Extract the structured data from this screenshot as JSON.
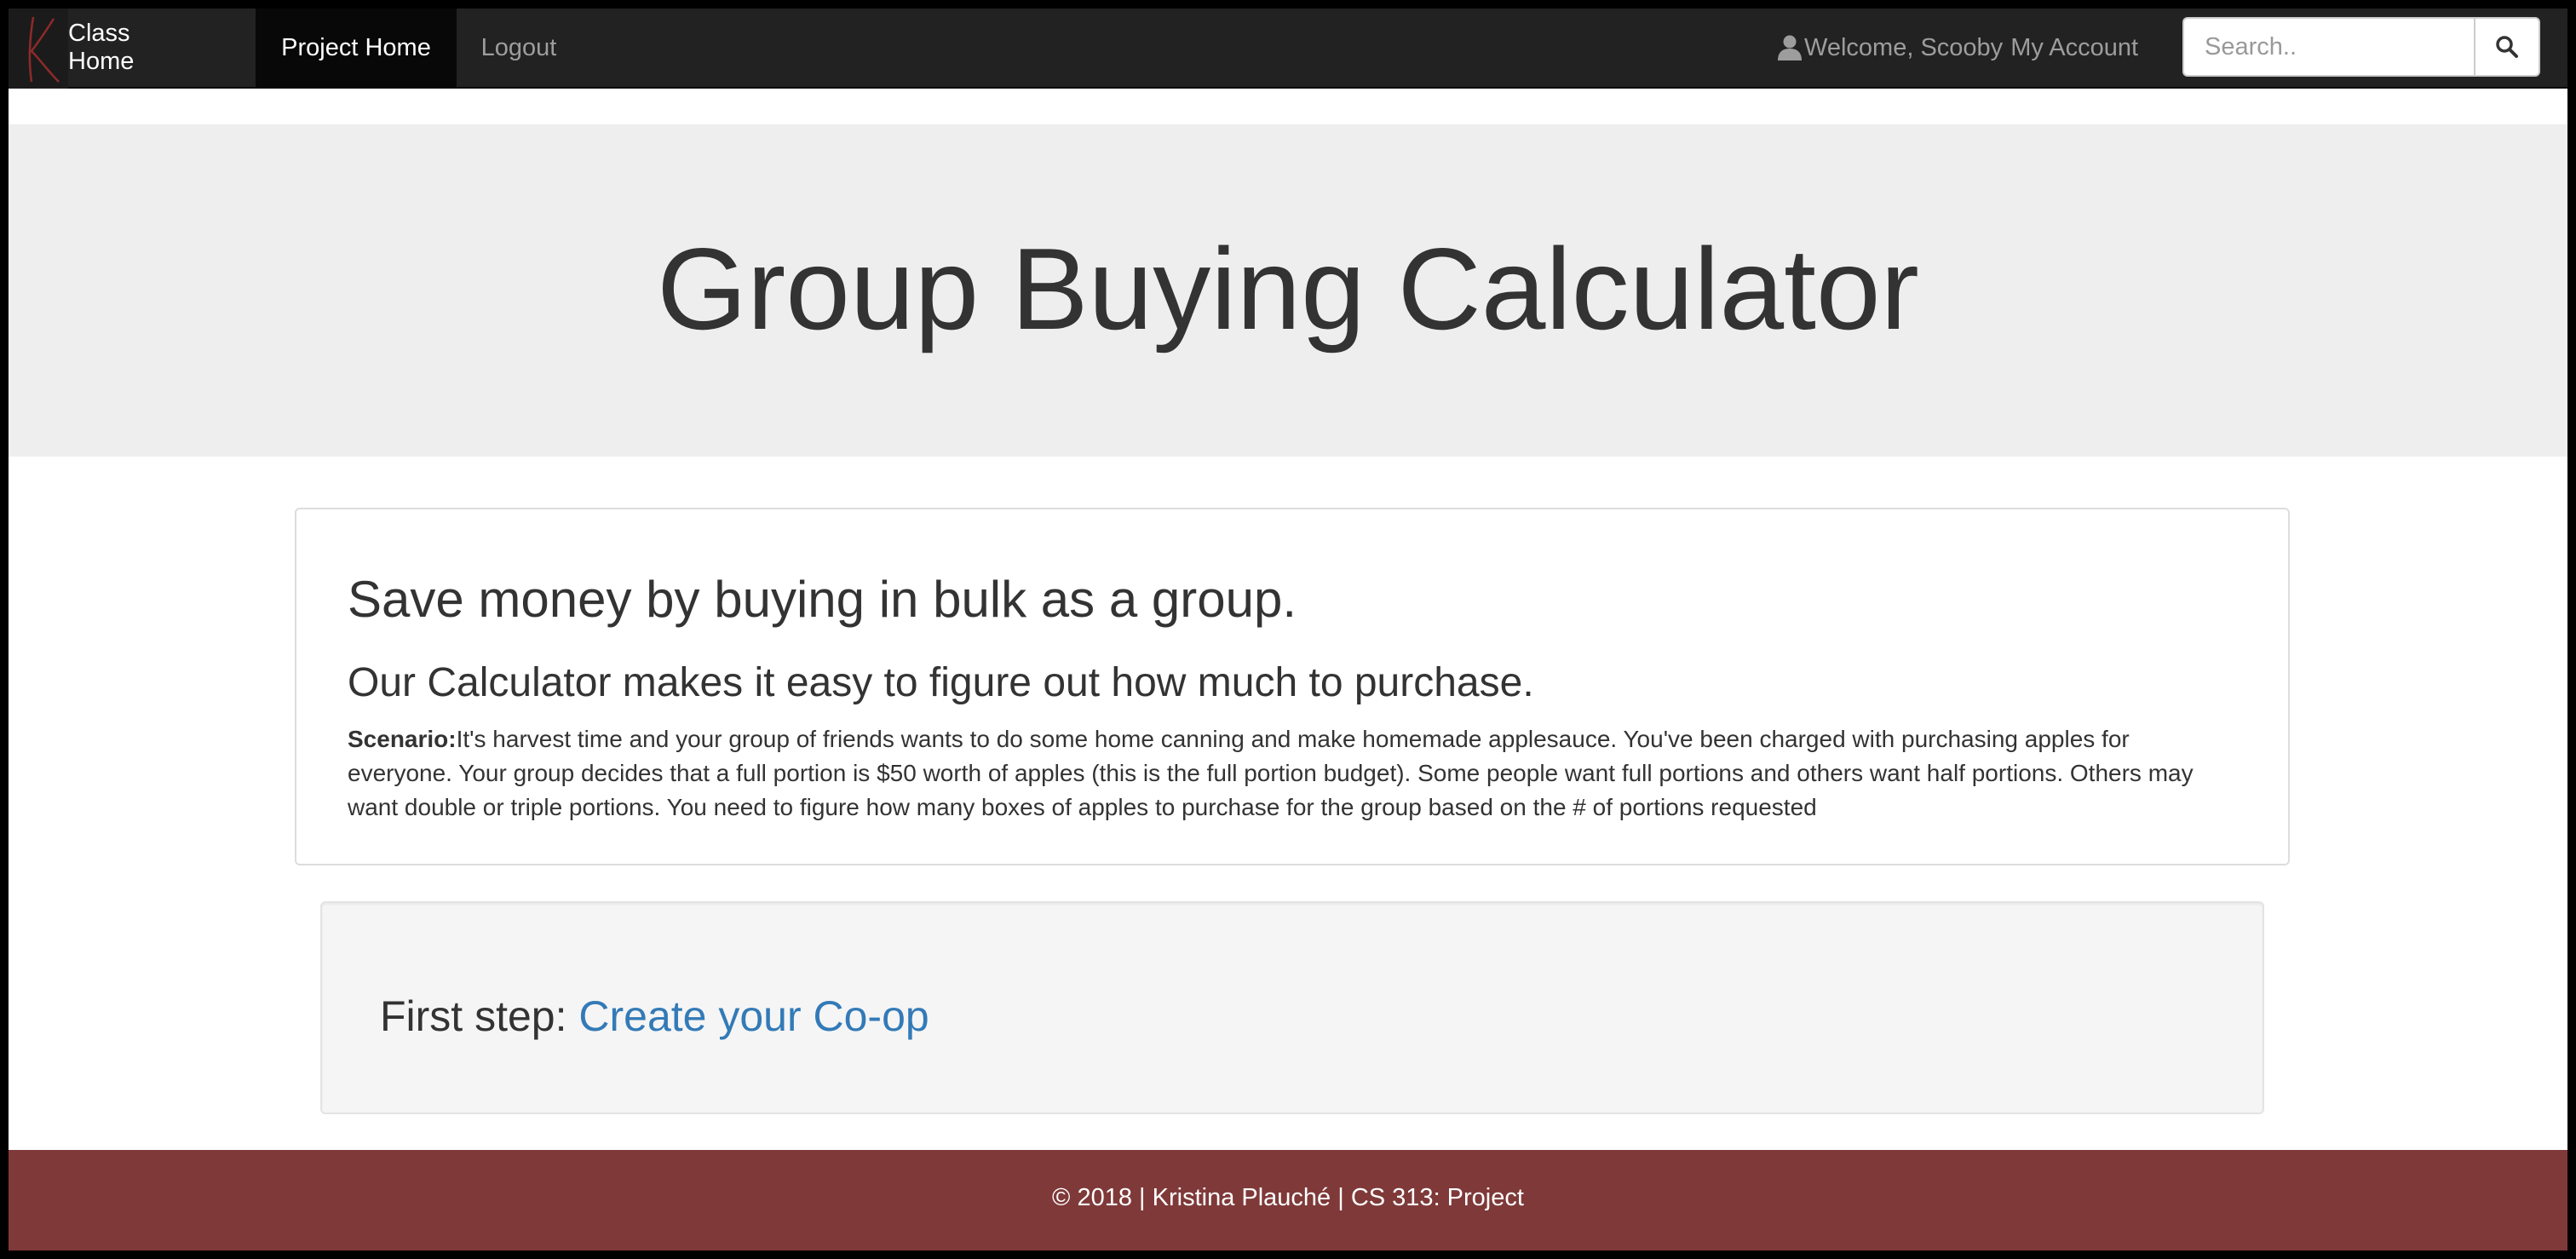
{
  "colors": {
    "navbar": "#222222",
    "navbar_active": "#080808",
    "jumbotron": "#eeeeee",
    "link": "#337ab7",
    "footer": "#7f3939"
  },
  "navbar": {
    "brand_icon": "k-logo-icon",
    "links": [
      {
        "label": "Class Home"
      },
      {
        "label": "Project Home"
      },
      {
        "label": "Logout"
      }
    ],
    "user_icon": "user-icon",
    "welcome_text": "Welcome, Scooby",
    "account_label": "My Account",
    "search": {
      "placeholder": "Search..",
      "value": "",
      "button_icon": "search-icon"
    }
  },
  "jumbotron": {
    "title": "Group Buying Calculator"
  },
  "intro": {
    "heading": "Save money by buying in bulk as a group.",
    "subheading": "Our Calculator makes it easy to figure out how much to purchase.",
    "scenario_label": "Scenario:",
    "scenario_text": "It's harvest time and your group of friends wants to do some home canning and make homemade applesauce. You've been charged with purchasing apples for everyone. Your group decides that a full portion is $50 worth of apples (this is the full portion budget). Some people want full portions and others want half portions. Others may want double or triple portions. You need to figure how many boxes of apples to purchase for the group based on the # of portions requested"
  },
  "first_step": {
    "label": "First step:",
    "link": "Create your Co-op"
  },
  "footer": {
    "text": "© 2018 | Kristina Plauché | CS 313: Project"
  }
}
